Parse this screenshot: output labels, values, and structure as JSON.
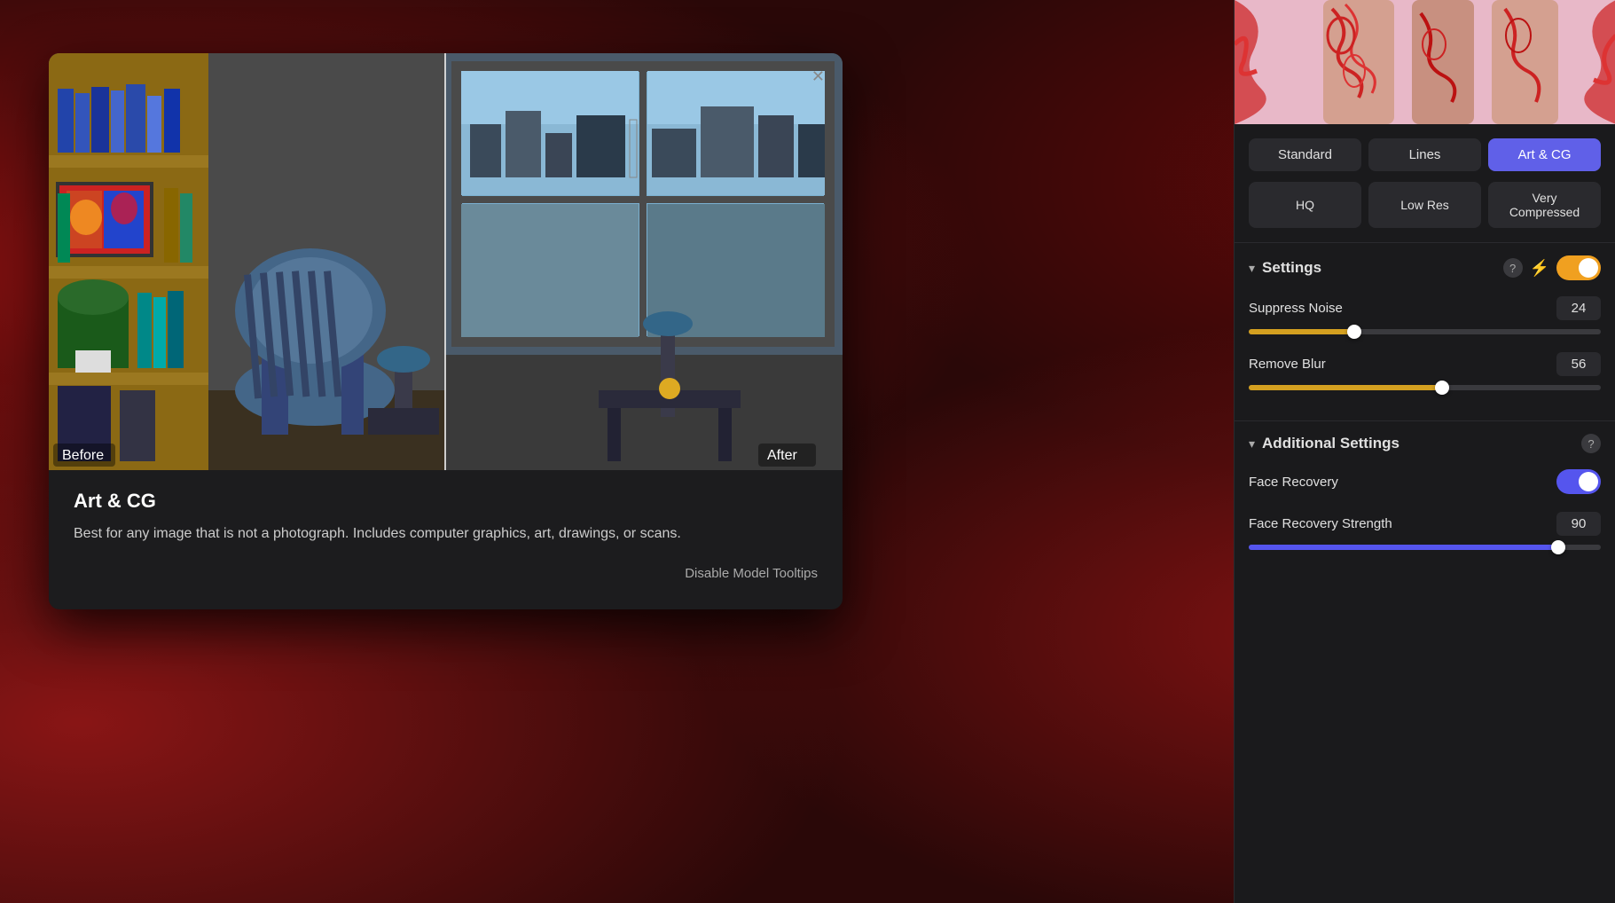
{
  "background": {
    "color": "#2a0808"
  },
  "tooltip_modal": {
    "title": "Art & CG",
    "description": "Best for any image that is not a photograph. Includes computer graphics, art, drawings, or scans.",
    "before_label": "Before",
    "after_label": "After",
    "close_icon": "✕",
    "disable_tooltips": "Disable Model Tooltips"
  },
  "model_tabs": [
    {
      "label": "Standard",
      "active": false
    },
    {
      "label": "Lines",
      "active": false
    },
    {
      "label": "Art & CG",
      "active": true
    }
  ],
  "quality_tabs": [
    {
      "label": "HQ",
      "active": false
    },
    {
      "label": "Low Res",
      "active": false
    },
    {
      "label": "Very Compressed",
      "active": false
    }
  ],
  "settings_section": {
    "title": "Settings",
    "help_label": "?",
    "lightning_icon": "⚡",
    "toggle_on": true,
    "suppress_noise": {
      "label": "Suppress Noise",
      "value": 24,
      "percent": 30
    },
    "remove_blur": {
      "label": "Remove Blur",
      "value": 56,
      "percent": 55
    }
  },
  "additional_settings": {
    "title": "Additional Settings",
    "help_label": "?",
    "face_recovery": {
      "label": "Face Recovery",
      "enabled": true
    },
    "face_recovery_strength": {
      "label": "Face Recovery Strength",
      "value": 90,
      "percent": 88
    }
  }
}
